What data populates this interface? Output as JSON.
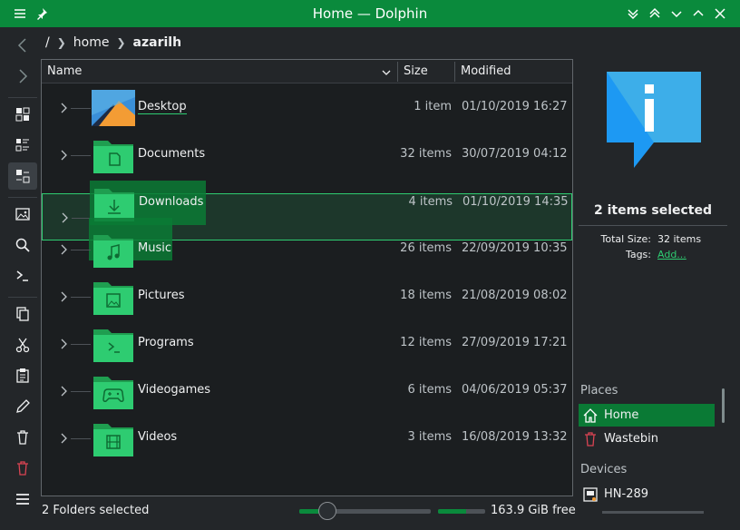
{
  "window": {
    "title": "Home — Dolphin"
  },
  "breadcrumb": {
    "root": "/",
    "items": [
      "home",
      "azarilh"
    ]
  },
  "columns": {
    "name": "Name",
    "size": "Size",
    "modified": "Modified"
  },
  "files": [
    {
      "name": "Desktop",
      "size": "1 item",
      "modified": "01/10/2019 16:27",
      "icon": "desktop-icon"
    },
    {
      "name": "Documents",
      "size": "32 items",
      "modified": "30/07/2019 04:12",
      "icon": "folder-documents-icon"
    },
    {
      "name": "Downloads",
      "size": "4 items",
      "modified": "01/10/2019 14:35",
      "icon": "folder-downloads-icon"
    },
    {
      "name": "Music",
      "size": "26 items",
      "modified": "22/09/2019 10:35",
      "icon": "folder-music-icon"
    },
    {
      "name": "Pictures",
      "size": "18 items",
      "modified": "21/08/2019 08:02",
      "icon": "folder-pictures-icon"
    },
    {
      "name": "Programs",
      "size": "12 items",
      "modified": "27/09/2019 17:21",
      "icon": "folder-programs-icon"
    },
    {
      "name": "Videogames",
      "size": "6 items",
      "modified": "04/06/2019 05:37",
      "icon": "folder-games-icon"
    },
    {
      "name": "Videos",
      "size": "3 items",
      "modified": "16/08/2019 13:32",
      "icon": "folder-videos-icon"
    }
  ],
  "info": {
    "selection_title": "2 items selected",
    "total_size_label": "Total Size:",
    "total_size_value": "32 items",
    "tags_label": "Tags:",
    "tags_link": "Add..."
  },
  "places": {
    "header": "Places",
    "items": [
      {
        "label": "Home",
        "active": true
      },
      {
        "label": "Wastebin",
        "active": false
      }
    ]
  },
  "devices": {
    "header": "Devices",
    "items": [
      {
        "label": "HN-289"
      }
    ]
  },
  "status": {
    "text": "2 Folders selected",
    "free_space": "163.9 GiB free",
    "zoom_level": 0.2,
    "disk_usage": 0.6
  },
  "colors": {
    "accent": "#0a8a3c",
    "background": "#232629",
    "view_background": "#1b1e20",
    "folder": "#2ecc71",
    "trash": "#da4453",
    "info_icon": "#1d99f3"
  }
}
